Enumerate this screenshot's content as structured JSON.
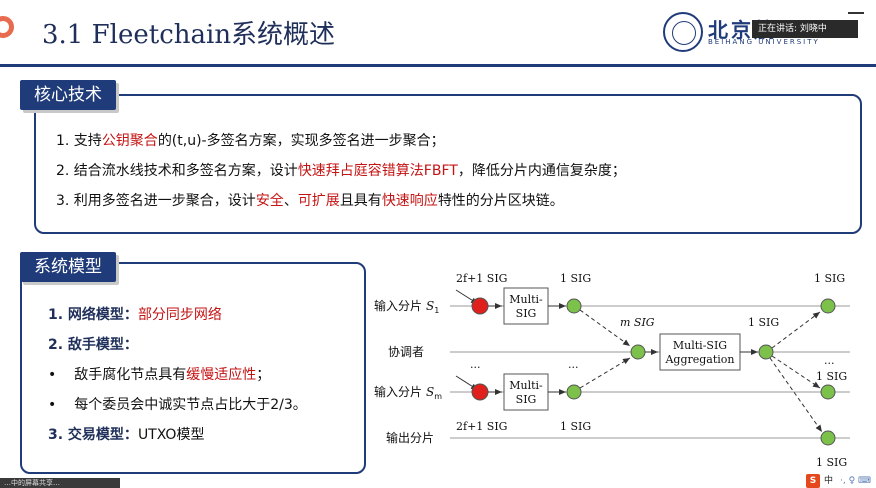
{
  "header": {
    "title": "3.1 Fleetchain系统概述",
    "logo_cn": "北京航",
    "logo_en": "BEIHANG UNIVERSITY",
    "speaker_tag": "正在讲话: 刘晓中",
    "accent_color": "#1f3b7a",
    "highlight_color": "#c41414"
  },
  "tech": {
    "label": "核心技术",
    "line1": {
      "a": "1. 支持",
      "b": "公钥聚合",
      "c": "的(t,u)-多签名方案，实现多签名进一步聚合；"
    },
    "line2": {
      "a": "2. 结合流水线技术和多签名方案，设计",
      "b": "快速拜占庭容错算法FBFT",
      "c": "，降低分片内通信复杂度；"
    },
    "line3": {
      "a": "3. 利用多签名进一步聚合，设计",
      "b": "安全",
      "c": "、",
      "d": "可扩展",
      "e": "且具有",
      "f": "快速响应",
      "g": "特性的分片区块链。"
    }
  },
  "model": {
    "label": "系统模型",
    "network": {
      "key": "1. 网络模型：",
      "val": "部分同步网络"
    },
    "adversary": {
      "key": "2. 敌手模型："
    },
    "bullet1": {
      "dot": "•",
      "a": "敌手腐化节点具有",
      "b": "缓慢适应性",
      "c": "；"
    },
    "bullet2": {
      "dot": "•",
      "a": "每个委员会中诚实节点占比大于2/3",
      "c": "。"
    },
    "transaction": {
      "key": "3. 交易模型：",
      "val": "UTXO模型"
    }
  },
  "diagram": {
    "rows": [
      "输入分片 S1",
      "协调者",
      "输入分片 Sm",
      "输出分片"
    ],
    "row1": "输入分片",
    "row1_sym": "S",
    "row1_sub": "1",
    "row2": "协调者",
    "row3": "输入分片",
    "row3_sym": "S",
    "row3_sub": "m",
    "row4": "输出分片",
    "sig_2f1_top": "2f+1 SIG",
    "sig_1_top_a": "1 SIG",
    "sig_1_top_b": "1 SIG",
    "multi_sig_top_1": "Multi-",
    "multi_sig_top_2": "SIG",
    "m_sig": "m SIG",
    "sig_1_mid": "1 SIG",
    "agg_1": "Multi-SIG",
    "agg_2": "Aggregation",
    "ellipsis_left": "...",
    "ellipsis_mid": "...",
    "ellipsis_right": "...",
    "sig_1_right_mid": "1 SIG",
    "multi_sig_bot_1": "Multi-",
    "multi_sig_bot_2": "SIG",
    "sig_2f1_bot": "2f+1 SIG",
    "sig_1_bot": "1 SIG",
    "sig_1_right_bot": "1 SIG"
  },
  "taskbar": {
    "caption": "…中的屏幕共享…",
    "ime_s": "S",
    "ime_zh": "中",
    "ime_dots": "·, ♀ ⌨"
  }
}
